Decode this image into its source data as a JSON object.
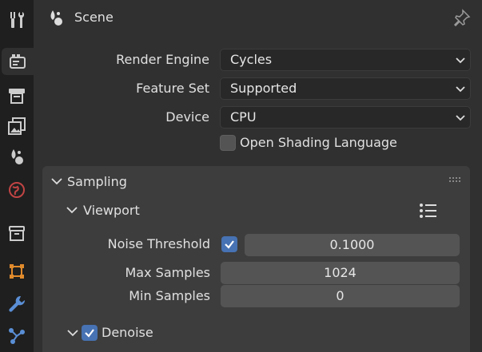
{
  "header": {
    "title": "Scene"
  },
  "tabs": [
    {
      "icon": "tool-icon"
    },
    {
      "icon": "render-icon",
      "active": true
    },
    {
      "icon": "output-icon"
    },
    {
      "icon": "view-layer-icon"
    },
    {
      "icon": "scene-icon"
    },
    {
      "icon": "world-icon"
    },
    {
      "icon": "collection-icon"
    },
    {
      "icon": "object-icon"
    },
    {
      "icon": "modifier-icon"
    },
    {
      "icon": "particles-icon"
    }
  ],
  "render": {
    "engine_label": "Render Engine",
    "engine_value": "Cycles",
    "feature_label": "Feature Set",
    "feature_value": "Supported",
    "device_label": "Device",
    "device_value": "CPU",
    "osl_label": "Open Shading Language",
    "osl_checked": false
  },
  "sampling": {
    "title": "Sampling",
    "viewport": {
      "title": "Viewport",
      "noise_threshold_label": "Noise Threshold",
      "noise_threshold_enabled": true,
      "noise_threshold_value": "0.1000",
      "max_samples_label": "Max Samples",
      "max_samples_value": "1024",
      "min_samples_label": "Min Samples",
      "min_samples_value": "0",
      "denoise_label": "Denoise",
      "denoise_checked": true
    }
  },
  "colors": {
    "accent": "#4772b3",
    "tab_bar": "#1f1f1f",
    "panel_bg": "#3d3d3d",
    "editor_bg": "#303030"
  }
}
